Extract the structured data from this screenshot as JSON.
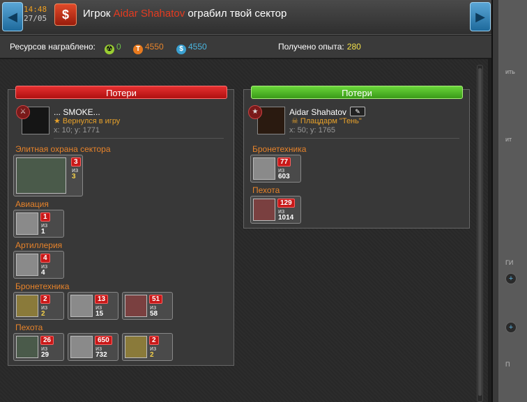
{
  "header": {
    "time": "14:48",
    "date": "27/05",
    "title_prefix": "Игрок",
    "player": "Aidar Shahatov",
    "title_suffix": "ограбил твой сектор",
    "alert_icon": "dollar-shield-icon"
  },
  "resources": {
    "label": "Ресурсов награблено:",
    "radiation": "0",
    "titanium": "4550",
    "credits": "4550",
    "exp_label": "Получено опыта:",
    "exp_value": "280"
  },
  "side": {
    "text1": "ить",
    "text2": "ит",
    "text3": "ГИ",
    "text4": "П"
  },
  "left_panel": {
    "header": "Потери",
    "player_name": "... SMOKE...",
    "status": "Вернулся в игру",
    "coords": "x: 10; y: 1771",
    "sections": [
      {
        "title": "Элитная охрана сектора",
        "units": [
          {
            "lost": "3",
            "of": "из",
            "total": "3"
          }
        ]
      },
      {
        "title": "Авиация",
        "units": [
          {
            "lost": "1",
            "of": "из",
            "total": "1"
          }
        ]
      },
      {
        "title": "Артиллерия",
        "units": [
          {
            "lost": "4",
            "of": "из",
            "total": "4"
          }
        ]
      },
      {
        "title": "Бронетехника",
        "units": [
          {
            "lost": "2",
            "of": "из",
            "total": "2"
          },
          {
            "lost": "13",
            "of": "из",
            "total": "15"
          },
          {
            "lost": "51",
            "of": "из",
            "total": "58"
          }
        ]
      },
      {
        "title": "Пехота",
        "units": [
          {
            "lost": "26",
            "of": "из",
            "total": "29"
          },
          {
            "lost": "650",
            "of": "из",
            "total": "732"
          },
          {
            "lost": "2",
            "of": "из",
            "total": "2"
          }
        ]
      }
    ]
  },
  "right_panel": {
    "header": "Потери",
    "player_name": "Aidar Shahatov",
    "status": "Плацдарм \"Тень\"",
    "coords": "x: 50; y: 1765",
    "sections": [
      {
        "title": "Бронетехника",
        "units": [
          {
            "lost": "77",
            "of": "из",
            "total": "603"
          }
        ]
      },
      {
        "title": "Пехота",
        "units": [
          {
            "lost": "129",
            "of": "из",
            "total": "1014"
          }
        ]
      }
    ]
  }
}
